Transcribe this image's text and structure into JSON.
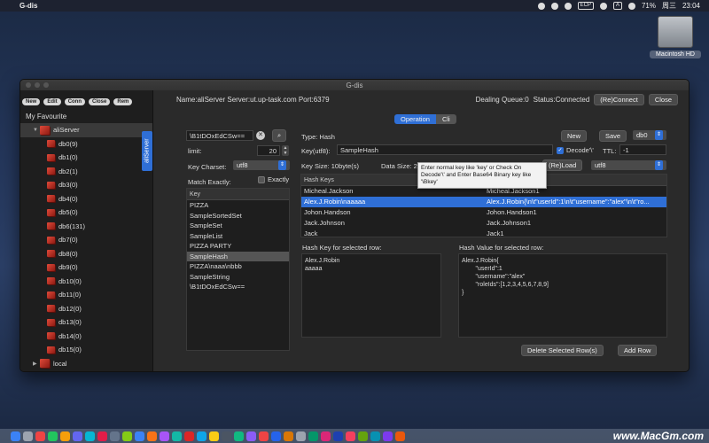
{
  "menubar": {
    "app_name": "G-dis",
    "battery": "71%",
    "input_badge": "ECP",
    "lang_badge": "A",
    "clock": "23:04",
    "day": "周三"
  },
  "desktop": {
    "hd_label": "Macintosh HD"
  },
  "window": {
    "title": "G-dis"
  },
  "sidebar": {
    "buttons": [
      "New",
      "Edit",
      "Conn",
      "Close",
      "Rem"
    ],
    "favourite_label": "My Favourite",
    "server": "aliServer",
    "dbs": [
      "db0(9)",
      "db1(0)",
      "db2(1)",
      "db3(0)",
      "db4(0)",
      "db5(0)",
      "db6(131)",
      "db7(0)",
      "db8(0)",
      "db9(0)",
      "db10(0)",
      "db11(0)",
      "db12(0)",
      "db13(0)",
      "db14(0)",
      "db15(0)"
    ],
    "local": "local"
  },
  "side_tab": "aliServer",
  "infobar": {
    "server_info": "Name:aliServer Server:ut.up-task.com Port:6379",
    "queue": "Dealing Queue:0",
    "status": "Status:Connected",
    "reconnect": "(Re)Connect",
    "close": "Close"
  },
  "tabs": {
    "operation": "Operation",
    "cli": "Cli"
  },
  "left": {
    "search_value": "\\B1tDOxEdCSw==",
    "limit_label": "limit:",
    "limit_value": "20",
    "charset_label": "Key Charset:",
    "charset_value": "utf8",
    "match_label": "Match Exactly:",
    "exactly_label": "Exactly",
    "key_header": "Key",
    "keys": [
      "PIZZA",
      "SampleSortedSet",
      "SampleSet",
      "SampleList",
      "PIZZA PARTY",
      "SampleHash",
      "PIZZA\\naaa\\nbbb",
      "SampleString",
      "\\B1tDOxEdCSw=="
    ],
    "selected_key": "SampleHash"
  },
  "right": {
    "type_label": "Type: Hash",
    "new_btn": "New",
    "save_btn": "Save",
    "db_value": "db0",
    "key_label": "Key(utf8):",
    "key_value": "SampleHash",
    "decode_label": "Decode'\\'",
    "ttl_label": "TTL:",
    "ttl_value": "-1",
    "keysize": "Key Size: 10byte(s)",
    "datasize": "Data Size: 2",
    "reload_btn": "(Re)Load",
    "value_charset": "utf8",
    "tooltip": "Enter normal key like 'key' or Check On Decode'\\' and Enter Base64 Binary key like '\\Bkey'",
    "hash_keys_header": "Hash Keys",
    "rows": [
      {
        "k": "Micheal.Jackson",
        "v": "Micheal.Jackson1"
      },
      {
        "k": "Alex.J.Robin\\naaaaa",
        "v": "Alex.J.Robin{\\n\\t\"userId\":1\\n\\t\"username\":\"alex\"\\n\\t\"ro..."
      },
      {
        "k": "Johon.Handson",
        "v": "Johon.Handson1"
      },
      {
        "k": "Jack.Johnson",
        "v": "Jack.Johnson1"
      },
      {
        "k": "Jack",
        "v": "Jack1"
      }
    ],
    "selected_row": 1,
    "hashkey_label": "Hash Key for selected row:",
    "hashkey_text": "Alex.J.Robin\naaaaa",
    "hashvalue_label": "Hash Value for selected row:",
    "hashvalue_text": "Alex.J.Robin{\n        \"userId\":1\n        \"username\":\"alex\"\n        \"roleIds\":[1,2,3,4,5,6,7,8,9]\n}",
    "delete_btn": "Delete Selected Row(s)",
    "add_btn": "Add Row"
  },
  "watermark": "www.MacGm.com",
  "colors": {
    "accent": "#2f6fd6",
    "cube": "#d43a2a"
  }
}
